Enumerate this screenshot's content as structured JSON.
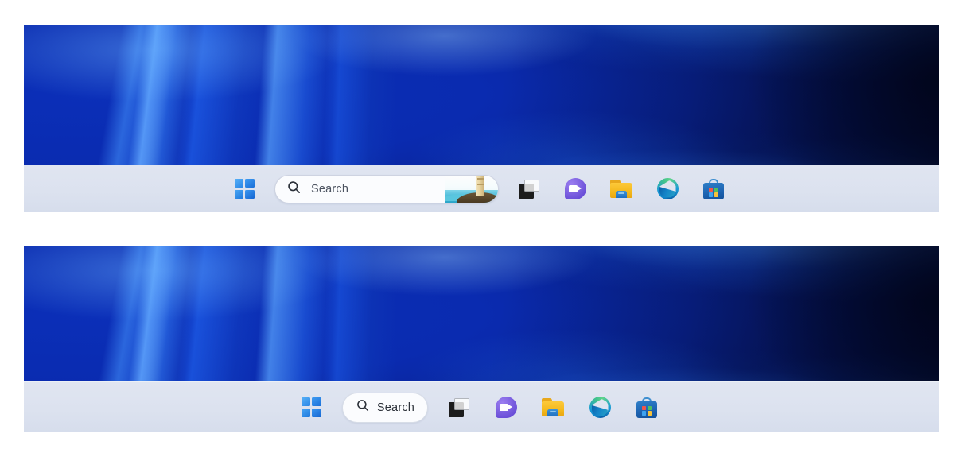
{
  "page": {
    "title": "Windows 11 taskbar comparison",
    "panel_count": 2,
    "background_color": "#ffffff"
  },
  "theme": {
    "taskbar_background": "#dce2ef",
    "wallpaper_base_color": "#0a2fd0",
    "accent_blue": "#2f8ae8",
    "search_field_background": "#fbfcfe",
    "search_text_color": "#4c5360"
  },
  "panels": [
    {
      "id": "panel-top",
      "name": "taskbar-with-expanded-search-box",
      "wallpaper": {
        "name": "windows-11-bloom-wallpaper"
      },
      "taskbar": {
        "search": {
          "variant": "wide",
          "label": "Search",
          "placeholder": "Search",
          "icon": "search-icon",
          "bing_image": "lighthouse-daily-image"
        },
        "items": [
          {
            "name": "start-button",
            "icon": "windows-logo-icon",
            "label": "Start"
          },
          {
            "name": "search-box",
            "icon": "search-icon",
            "label": "Search"
          },
          {
            "name": "task-view-button",
            "icon": "task-view-icon",
            "label": "Task View"
          },
          {
            "name": "chat-button",
            "icon": "chat-icon",
            "label": "Chat"
          },
          {
            "name": "file-explorer-button",
            "icon": "folder-icon",
            "label": "File Explorer"
          },
          {
            "name": "edge-button",
            "icon": "edge-icon",
            "label": "Microsoft Edge"
          },
          {
            "name": "store-button",
            "icon": "store-icon",
            "label": "Microsoft Store"
          }
        ]
      }
    },
    {
      "id": "panel-bottom",
      "name": "taskbar-with-compact-search-pill",
      "wallpaper": {
        "name": "windows-11-bloom-wallpaper"
      },
      "taskbar": {
        "search": {
          "variant": "pill",
          "label": "Search",
          "placeholder": "Search",
          "icon": "search-icon",
          "bing_image": null
        },
        "items": [
          {
            "name": "start-button",
            "icon": "windows-logo-icon",
            "label": "Start"
          },
          {
            "name": "search-pill",
            "icon": "search-icon",
            "label": "Search"
          },
          {
            "name": "task-view-button",
            "icon": "task-view-icon",
            "label": "Task View"
          },
          {
            "name": "chat-button",
            "icon": "chat-icon",
            "label": "Chat"
          },
          {
            "name": "file-explorer-button",
            "icon": "folder-icon",
            "label": "File Explorer"
          },
          {
            "name": "edge-button",
            "icon": "edge-icon",
            "label": "Microsoft Edge"
          },
          {
            "name": "store-button",
            "icon": "store-icon",
            "label": "Microsoft Store"
          }
        ]
      }
    }
  ]
}
